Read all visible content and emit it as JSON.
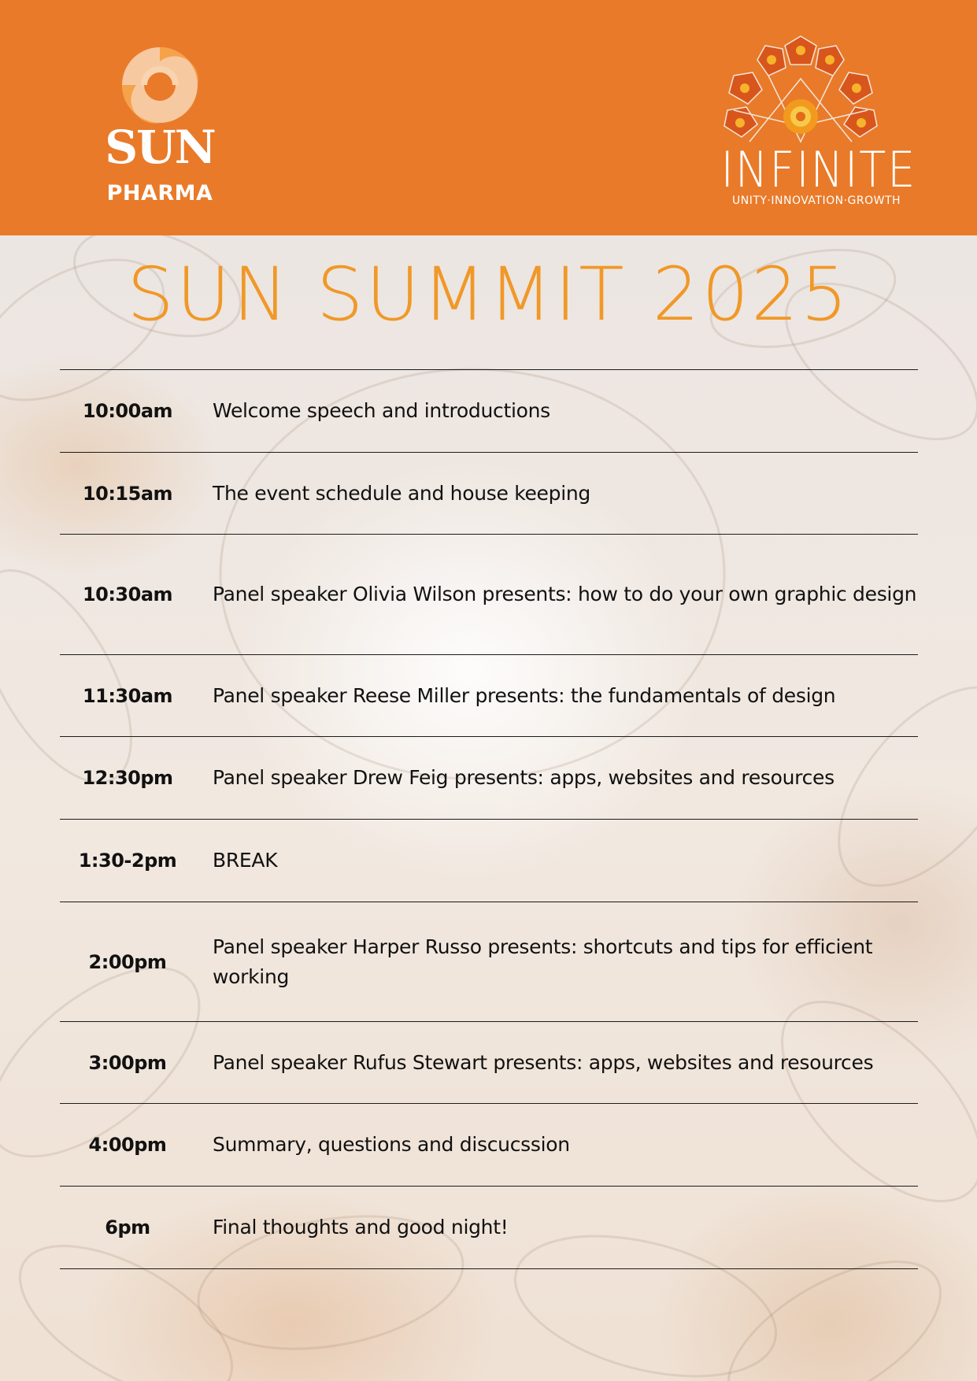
{
  "header": {
    "brand_name": "SUN",
    "brand_sub": "PHARMA",
    "campaign_name": "INFINITE",
    "campaign_tagline": "UNITY·INNOVATION·GROWTH",
    "color": "#e97a29"
  },
  "title": "SUN SUMMIT 2025",
  "colors": {
    "title": "#f09828",
    "rule": "#1b1b1b"
  },
  "schedule": [
    {
      "time": "10:00am",
      "description": "Welcome speech and introductions"
    },
    {
      "time": "10:15am",
      "description": "The event schedule and house keeping"
    },
    {
      "time": "10:30am",
      "description": "Panel speaker Olivia Wilson presents: how to do your own graphic design"
    },
    {
      "time": "11:30am",
      "description": "Panel speaker Reese Miller presents: the fundamentals of design"
    },
    {
      "time": "12:30pm",
      "description": "Panel speaker Drew Feig presents: apps, websites and resources"
    },
    {
      "time": "1:30-2pm",
      "description": "BREAK"
    },
    {
      "time": "2:00pm",
      "description": "Panel speaker Harper Russo presents: shortcuts and tips for efficient working"
    },
    {
      "time": "3:00pm",
      "description": "Panel speaker Rufus Stewart presents: apps, websites and resources"
    },
    {
      "time": "4:00pm",
      "description": "Summary, questions and discucssion"
    },
    {
      "time": "6pm",
      "description": "Final thoughts and good night!"
    }
  ]
}
